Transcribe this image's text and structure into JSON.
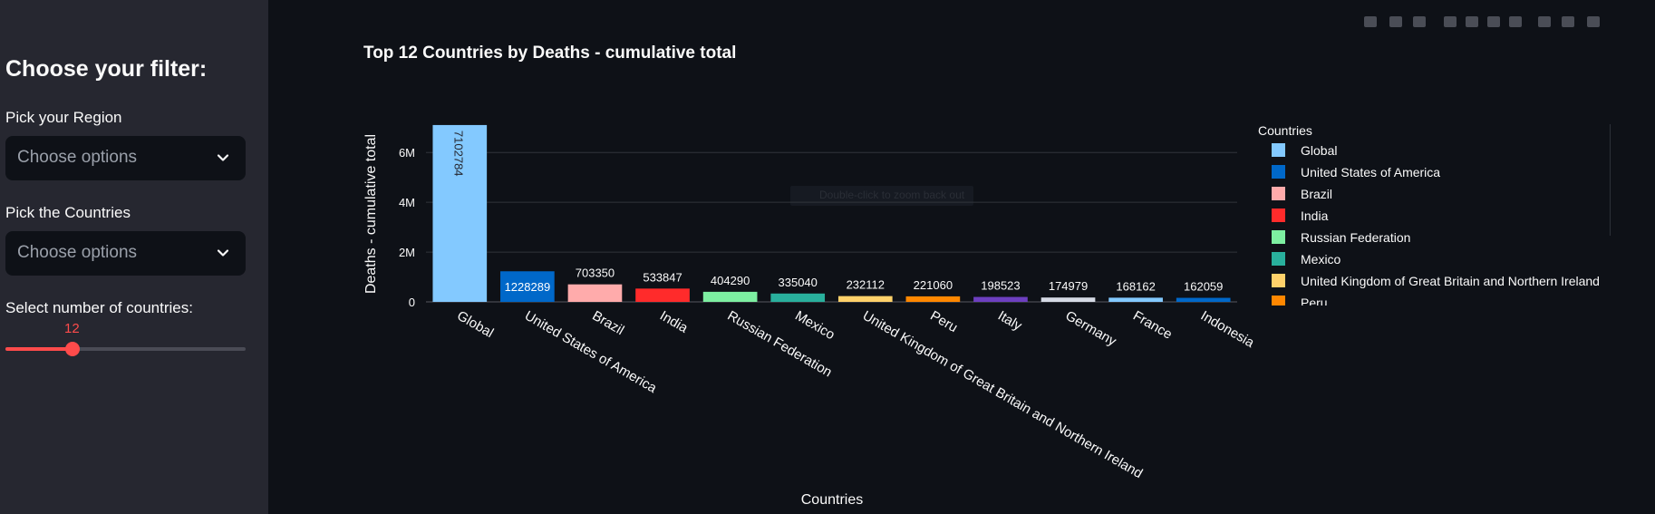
{
  "sidebar": {
    "title": "Choose your filter:",
    "region_label": "Pick your Region",
    "region_placeholder": "Choose options",
    "countries_label": "Pick the Countries",
    "countries_placeholder": "Choose options",
    "count_label": "Select number of countries:",
    "count_value": "12",
    "count_fraction": 0.28
  },
  "colors": {
    "accent": "#ff4b4b",
    "background": "#0e1117",
    "sidebar": "#262730"
  },
  "modebar_icons": [
    "camera-icon",
    "zoom-icon",
    "pan-icon",
    "box-select-icon",
    "lasso-icon",
    "zoom-in-icon",
    "zoom-out-icon",
    "autoscale-icon",
    "reset-axes-icon",
    "fullscreen-icon"
  ],
  "chart_hint": "Double-click to zoom back out",
  "chart_data": {
    "type": "bar",
    "title": "Top 12 Countries by Deaths - cumulative total",
    "xlabel": "Countries",
    "ylabel": "Deaths - cumulative total",
    "ylim": [
      0,
      7100000
    ],
    "yticks": [
      0,
      2000000,
      4000000,
      6000000
    ],
    "ytick_labels": [
      "0",
      "2M",
      "4M",
      "6M"
    ],
    "grid": true,
    "legend_title": "Countries",
    "legend_position": "right",
    "categories": [
      "Global",
      "United States of America",
      "Brazil",
      "India",
      "Russian Federation",
      "Mexico",
      "United Kingdom of Great Britain and Northern Ireland",
      "Peru",
      "Italy",
      "Germany",
      "France",
      "Indonesia"
    ],
    "values": [
      7102784,
      1228289,
      703350,
      533847,
      404290,
      335040,
      232112,
      221060,
      198523,
      174979,
      168162,
      162059
    ],
    "labels": [
      "7102784",
      "1228289",
      "703350",
      "533847",
      "404290",
      "335040",
      "232112",
      "221060",
      "198523",
      "174979",
      "168162",
      "162059"
    ],
    "colors": [
      "#83c9ff",
      "#0068c9",
      "#ffabab",
      "#ff2b2b",
      "#7defa1",
      "#29b09d",
      "#ffd16a",
      "#ff8700",
      "#6d3fc0",
      "#d5dae5",
      "#83c9ff",
      "#0068c9"
    ],
    "legend_visible": [
      "Global",
      "United States of America",
      "Brazil",
      "India",
      "Russian Federation",
      "Mexico",
      "United Kingdom of Great Britain and Northern Ireland",
      "Peru"
    ],
    "legend_visible_label": [
      "Global",
      "United States of America",
      "Brazil",
      "India",
      "Russian Federation",
      "Mexico",
      "United Kingdom of Great Britain and Northern Ireland",
      "Peru"
    ]
  }
}
